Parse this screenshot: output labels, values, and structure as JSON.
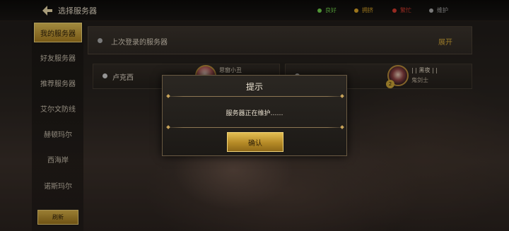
{
  "header": {
    "title": "选择服务器",
    "legend": [
      {
        "label": "良好",
        "color": "#6fcf4a"
      },
      {
        "label": "拥挤",
        "color": "#d8a328"
      },
      {
        "label": "繁忙",
        "color": "#d23b2f"
      },
      {
        "label": "维护",
        "color": "#a8a8a8"
      }
    ]
  },
  "sidebar": {
    "items": [
      {
        "label": "我的服务器",
        "active": true
      },
      {
        "label": "好友服务器"
      },
      {
        "label": "推荐服务器"
      },
      {
        "label": "艾尔文防线"
      },
      {
        "label": "赫顿玛尔"
      },
      {
        "label": "西海岸"
      },
      {
        "label": "诺斯玛尔"
      }
    ],
    "refresh_label": "刷新"
  },
  "main": {
    "last_login_label": "上次登录的服务器",
    "expand_label": "展开",
    "servers": [
      {
        "name": "卢克西",
        "character": "思窗小丑",
        "class": ""
      },
      {
        "name": "",
        "character": "| | 黑夜 | |",
        "class": "鬼剑士",
        "level": "2"
      }
    ]
  },
  "modal": {
    "title": "提示",
    "message": "服务器正在维护……",
    "confirm_label": "确认"
  },
  "icons": {
    "back": "back-arrow-icon",
    "status_dot": "status-dot-icon"
  }
}
